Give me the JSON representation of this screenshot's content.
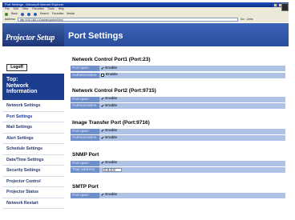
{
  "browser": {
    "title": "Port Settings - Microsoft Internet Explorer",
    "menu": [
      "File",
      "Edit",
      "View",
      "Favorites",
      "Tools",
      "Help"
    ],
    "toolbar": [
      "Back",
      "Search",
      "Favorites",
      "Media"
    ],
    "address_label": "Address",
    "address": "http://192.168.1.10/admin/portset.html",
    "go_label": "Go",
    "links_label": "Links"
  },
  "sidebar": {
    "brand": "Projector Setup",
    "logoff_label": "Logoff",
    "heading": [
      "Top:",
      "Network",
      "Information"
    ],
    "items": [
      {
        "label": "Network Settings"
      },
      {
        "label": "Port Settings"
      },
      {
        "label": "Mail Settings"
      },
      {
        "label": "Alert Settings"
      },
      {
        "label": "Schedule Settings"
      },
      {
        "label": "Date/Time Settings"
      },
      {
        "label": "Security Settings"
      },
      {
        "label": "Projector Control"
      },
      {
        "label": "Projector Status"
      },
      {
        "label": "Network Restart"
      }
    ]
  },
  "main": {
    "title": "Port Settings",
    "sections": [
      {
        "title": "Network Control Port1 (Port:23)",
        "rows": [
          {
            "label": "Port open",
            "value": "Enable",
            "checked": true
          },
          {
            "label": "Authentication",
            "value": "Enable",
            "checked": false
          }
        ]
      },
      {
        "title": "Network Control Port2 (Port:9715)",
        "rows": [
          {
            "label": "Port open",
            "value": "Enable",
            "checked": true
          },
          {
            "label": "Authentication",
            "value": "Enable",
            "checked": true
          }
        ]
      },
      {
        "title": "Image Transfer Port (Port:9716)",
        "rows": [
          {
            "label": "Port open",
            "value": "Enable",
            "checked": true
          },
          {
            "label": "Authentication",
            "value": "Enable",
            "checked": true
          }
        ]
      },
      {
        "title": "SNMP Port",
        "rows": [
          {
            "label": "Port open",
            "value": "Enable",
            "checked": true
          },
          {
            "label": "Trap address",
            "value": "0.0.0.0"
          }
        ]
      },
      {
        "title": "SMTP Port",
        "rows": [
          {
            "label": "Port open",
            "value": "Enable",
            "checked": true
          }
        ]
      }
    ]
  },
  "colors": {
    "header_blue": "#2a4e9e",
    "sidebar_heading": "#1d3d8f",
    "row_label": "#6f8fcb",
    "row_value": "#aec2e6"
  }
}
